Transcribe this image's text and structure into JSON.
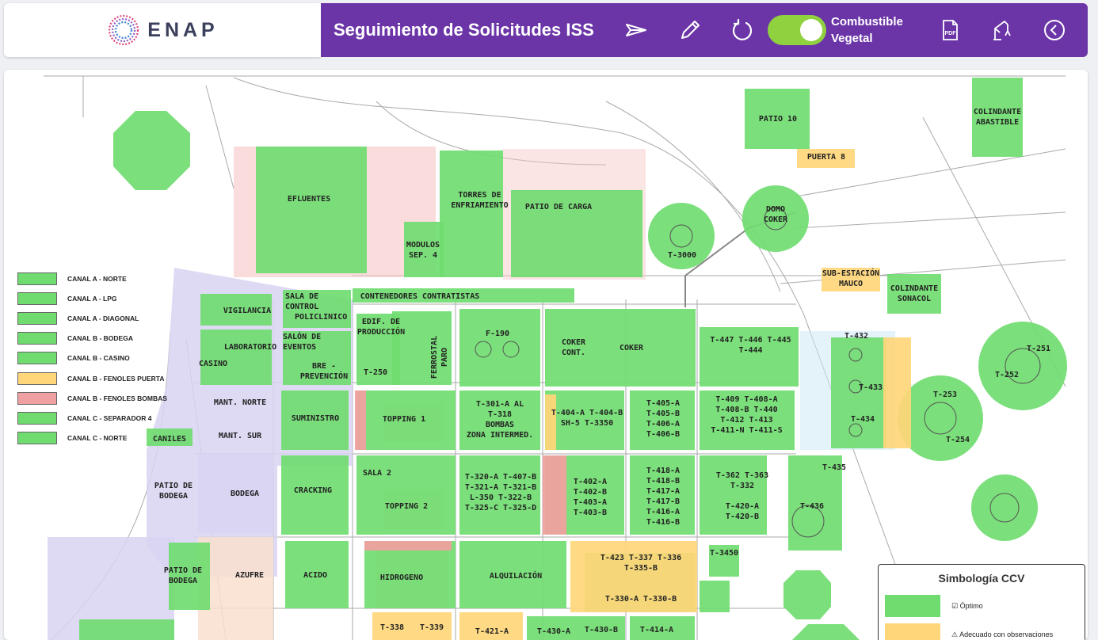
{
  "header": {
    "brand": "ENAP",
    "title": "Seguimiento de Solicitudes ISS",
    "toggle_label": "Combustible\nVegetal",
    "toggle_on": true,
    "icons": [
      "send-icon",
      "edit-icon",
      "refresh-icon",
      "pdf-icon",
      "crane-icon",
      "back-icon"
    ]
  },
  "colors": {
    "purple": "#6b35a8",
    "green": "#70dc70",
    "yellow": "#ffd67a",
    "red": "#f0a0a0",
    "lavender": "#d8d3f2",
    "peach": "#f9dfcf"
  },
  "legend": [
    {
      "label": "CANAL A - NORTE",
      "color": "#70dc70"
    },
    {
      "label": "CANAL A - LPG",
      "color": "#70dc70"
    },
    {
      "label": "CANAL A - DIAGONAL",
      "color": "#70dc70"
    },
    {
      "label": "CANAL B - BODEGA",
      "color": "#70dc70"
    },
    {
      "label": "CANAL B - CASINO",
      "color": "#70dc70"
    },
    {
      "label": "CANAL B - FENOLES PUERTA",
      "color": "#ffd67a"
    },
    {
      "label": "CANAL B - FENOLES BOMBAS",
      "color": "#f0a0a0"
    },
    {
      "label": "CANAL C - SEPARADOR 4",
      "color": "#70dc70"
    },
    {
      "label": "CANAL C - NORTE",
      "color": "#70dc70"
    }
  ],
  "simbologia": {
    "title": "Simbología CCV",
    "items": [
      {
        "label": "☑ Óptimo",
        "color": "#70dc70"
      },
      {
        "label": "⚠ Adecuado con observaciones",
        "color": "#ffd67a"
      }
    ]
  },
  "zones": [
    {
      "name": "patio-10",
      "label": "PATIO 10",
      "status": "green"
    },
    {
      "name": "colindante-abastible",
      "label": "COLINDANTE\nABASTIBLE",
      "status": "green"
    },
    {
      "name": "puerta-8",
      "label": "PUERTA 8",
      "status": "yellow"
    },
    {
      "name": "efluentes",
      "label": "EFLUENTES",
      "status": "green"
    },
    {
      "name": "torres-enfriamiento",
      "label": "TORRES DE\nENFRIAMIENTO",
      "status": "green"
    },
    {
      "name": "patio-de-carga",
      "label": "PATIO DE CARGA",
      "status": "green"
    },
    {
      "name": "modulos-sep4",
      "label": "MODULOS\nSEP. 4",
      "status": "green"
    },
    {
      "name": "domo-coker",
      "label": "DOMO\nCOKER",
      "status": "green"
    },
    {
      "name": "t-3000",
      "label": "T-3000",
      "status": "green"
    },
    {
      "name": "sub-estacion-mauco",
      "label": "SUB-ESTACIÓN\nMAUCO",
      "status": "yellow"
    },
    {
      "name": "colindante-sonacol",
      "label": "COLINDANTE\nSONACOL",
      "status": "green"
    },
    {
      "name": "vigilancia",
      "label": "VIGILANCIA",
      "status": "green"
    },
    {
      "name": "sala-control",
      "label": "SALA DE\nCONTROL\n  POLICLINICO",
      "status": "green"
    },
    {
      "name": "contenedores",
      "label": "CONTENEDORES CONTRATISTAS",
      "status": "green"
    },
    {
      "name": "laboratorio",
      "label": "LABORATORIO",
      "status": "green"
    },
    {
      "name": "casino",
      "label": "CASINO",
      "status": "green"
    },
    {
      "name": "salon-eventos",
      "label": "SALÓN DE\nEVENTOS",
      "status": "green"
    },
    {
      "name": "bre-prevencion",
      "label": "BRE -\nPREVENCIÓN",
      "status": "green"
    },
    {
      "name": "edif-produccion",
      "label": "EDIF. DE\nPRODUCCIÓN",
      "status": "green"
    },
    {
      "name": "t-250",
      "label": "T-250",
      "status": "green"
    },
    {
      "name": "ferrostal",
      "label": "FERROSTAL\nPARO",
      "status": "green"
    },
    {
      "name": "f-190",
      "label": "F-190",
      "status": "green"
    },
    {
      "name": "coker-cont",
      "label": "COKER\nCONT.",
      "status": "green"
    },
    {
      "name": "coker",
      "label": "COKER",
      "status": "green"
    },
    {
      "name": "t-447",
      "label": "T-447 T-446 T-445\nT-444",
      "status": "green"
    },
    {
      "name": "t-432",
      "label": "T-432",
      "status": "green"
    },
    {
      "name": "t-433",
      "label": "T-433",
      "status": "yellow"
    },
    {
      "name": "t-434",
      "label": "T-434",
      "status": "green"
    },
    {
      "name": "t-251",
      "label": "T-251",
      "status": "green"
    },
    {
      "name": "t-252",
      "label": "T-252",
      "status": "green"
    },
    {
      "name": "t-253",
      "label": "T-253",
      "status": "green"
    },
    {
      "name": "t-254",
      "label": "T-254",
      "status": "green"
    },
    {
      "name": "mant-norte",
      "label": "MANT. NORTE",
      "status": "lavender"
    },
    {
      "name": "mant-sur",
      "label": "MANT. SUR",
      "status": "lavender"
    },
    {
      "name": "caniles",
      "label": "CANILES",
      "status": "green"
    },
    {
      "name": "suministro",
      "label": "SUMINISTRO",
      "status": "green"
    },
    {
      "name": "topping-1",
      "label": "TOPPING 1",
      "status": "green"
    },
    {
      "name": "t-301",
      "label": "T-301-A AL\nT-318\nBOMBAS\nZONA INTERMED.",
      "status": "green"
    },
    {
      "name": "t-404",
      "label": "T-404-A T-404-B\nSH-5 T-3350",
      "status": "green"
    },
    {
      "name": "t-405",
      "label": "T-405-A\nT-405-B\nT-406-A\nT-406-B",
      "status": "green"
    },
    {
      "name": "t-409",
      "label": "T-409 T-408-A\nT-408-B T-440\nT-412 T-413\nT-411-N T-411-S",
      "status": "green"
    },
    {
      "name": "patio-bodega-1",
      "label": "PATIO DE\nBODEGA",
      "status": "lavender"
    },
    {
      "name": "bodega",
      "label": "BODEGA",
      "status": "lavender"
    },
    {
      "name": "cracking",
      "label": "CRACKING",
      "status": "green"
    },
    {
      "name": "sala-2",
      "label": "SALA 2",
      "status": "green"
    },
    {
      "name": "topping-2",
      "label": "TOPPING 2",
      "status": "green"
    },
    {
      "name": "t-320",
      "label": "T-320-A T-407-B\nT-321-A T-321-B\nL-350 T-322-B\nT-325-C T-325-D",
      "status": "green"
    },
    {
      "name": "t-402",
      "label": "T-402-A\nT-402-B\nT-403-A\nT-403-B",
      "status": "green"
    },
    {
      "name": "t-418",
      "label": "T-418-A\nT-418-B\nT-417-A\nT-417-B\nT-416-A\nT-416-B",
      "status": "green"
    },
    {
      "name": "t-362",
      "label": "T-362 T-363\nT-332\n\nT-420-A\nT-420-B",
      "status": "green"
    },
    {
      "name": "t-435",
      "label": "T-435",
      "status": "green"
    },
    {
      "name": "t-436",
      "label": "T-436",
      "status": "green"
    },
    {
      "name": "patio-bodega-2",
      "label": "PATIO DE\nBODEGA",
      "status": "green"
    },
    {
      "name": "azufre",
      "label": "AZUFRE",
      "status": "peach"
    },
    {
      "name": "acido",
      "label": "ACIDO",
      "status": "green"
    },
    {
      "name": "hidrogeno",
      "label": "HIDROGENO",
      "status": "green"
    },
    {
      "name": "alquilacion",
      "label": "ALQUILACIÓN",
      "status": "green"
    },
    {
      "name": "t-423",
      "label": "T-423 T-337 T-336\nT-335-B\n\n\nT-330-A T-330-B",
      "status": "green"
    },
    {
      "name": "t-3450",
      "label": "T-3450",
      "status": "green"
    },
    {
      "name": "t-338",
      "label": "T-338",
      "status": "yellow"
    },
    {
      "name": "t-339",
      "label": "T-339",
      "status": "yellow"
    },
    {
      "name": "t-421",
      "label": "T-421-A",
      "status": "yellow"
    },
    {
      "name": "t-430",
      "label": "T-430-A",
      "status": "green"
    },
    {
      "name": "t-430b",
      "label": "T-430-B",
      "status": "green"
    },
    {
      "name": "t-414",
      "label": "T-414-A",
      "status": "green"
    }
  ]
}
